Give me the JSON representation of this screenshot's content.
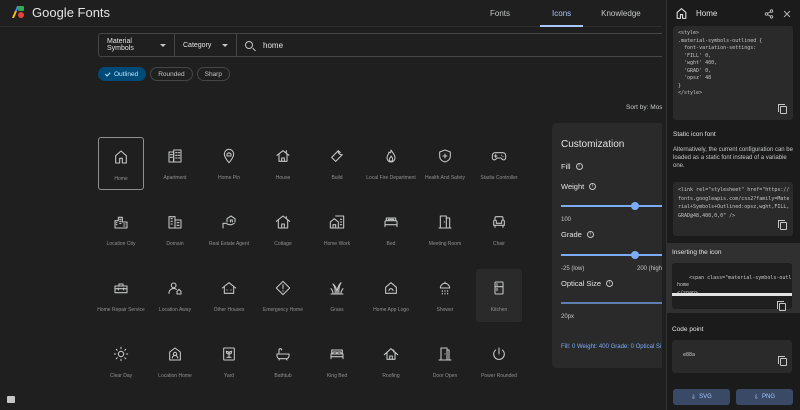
{
  "header": {
    "brand": "Google Fonts",
    "nav": [
      "Fonts",
      "Icons",
      "Knowledge",
      "F"
    ],
    "active_nav": "Icons"
  },
  "search": {
    "family": "Material Symbols",
    "category": "Category",
    "query": "home"
  },
  "styles": [
    "Outlined",
    "Rounded",
    "Sharp"
  ],
  "sort_label": "Sort by: Most",
  "icons": [
    {
      "label": "Home",
      "icon": "home-icon"
    },
    {
      "label": "Apartment",
      "icon": "apartment-icon"
    },
    {
      "label": "Home Pin",
      "icon": "home-pin-icon"
    },
    {
      "label": "House",
      "icon": "house-icon"
    },
    {
      "label": "Build",
      "icon": "build-icon"
    },
    {
      "label": "Local Fire Department",
      "icon": "fire-icon"
    },
    {
      "label": "Health And Safety",
      "icon": "health-icon"
    },
    {
      "label": "Stadia Controller",
      "icon": "controller-icon"
    },
    {
      "label": "Location City",
      "icon": "city-icon"
    },
    {
      "label": "Domain",
      "icon": "domain-icon"
    },
    {
      "label": "Real Estate Agent",
      "icon": "agent-icon"
    },
    {
      "label": "Cottage",
      "icon": "cottage-icon"
    },
    {
      "label": "Home Work",
      "icon": "home-work-icon"
    },
    {
      "label": "Bed",
      "icon": "bed-icon"
    },
    {
      "label": "Meeting Room",
      "icon": "meeting-room-icon"
    },
    {
      "label": "Chair",
      "icon": "chair-icon"
    },
    {
      "label": "Home Repair Service",
      "icon": "toolbox-icon"
    },
    {
      "label": "Location Away",
      "icon": "location-away-icon"
    },
    {
      "label": "Other Houses",
      "icon": "other-houses-icon"
    },
    {
      "label": "Emergency Home",
      "icon": "emergency-home-icon"
    },
    {
      "label": "Grass",
      "icon": "grass-icon"
    },
    {
      "label": "Home App Logo",
      "icon": "home-app-logo-icon"
    },
    {
      "label": "Shower",
      "icon": "shower-icon"
    },
    {
      "label": "Kitchen",
      "icon": "kitchen-icon"
    },
    {
      "label": "Clear Day",
      "icon": "sun-icon"
    },
    {
      "label": "Location Home",
      "icon": "location-home-icon"
    },
    {
      "label": "Yard",
      "icon": "yard-icon"
    },
    {
      "label": "Bathtub",
      "icon": "bathtub-icon"
    },
    {
      "label": "King Bed",
      "icon": "king-bed-icon"
    },
    {
      "label": "Roofing",
      "icon": "roofing-icon"
    },
    {
      "label": "Door Open",
      "icon": "door-open-icon"
    },
    {
      "label": "Power Rounded",
      "icon": "power-icon"
    }
  ],
  "customization": {
    "title": "Customization",
    "fill_label": "Fill",
    "weight_label": "Weight",
    "weight_min": "100",
    "weight_value": 400,
    "grade_label": "Grade",
    "grade_min": "-25 (low)",
    "grade_mid": "200 (high",
    "grade_value": 0,
    "optical_label": "Optical Size",
    "optical_min": "20px",
    "optical_value": 48,
    "summary": "Fill: 0 Weight: 400 Grade: 0 Optical Si"
  },
  "side": {
    "title": "Home",
    "style_code": "<style>\n.material-symbols-outlined {\n  font-variation-settings:\n  'FILL' 0,\n  'wght' 400,\n  'GRAD' 0,\n  'opsz' 48\n}\n</style>",
    "static_title": "Static icon font",
    "static_text": "Alternatively, the current configuration can be loaded as a static font instead of a variable one.",
    "link_code": "<link rel=\"stylesheet\" href=\"https://\nfonts.googleapis.com/css2?family=Mate\nrial+Symbols+Outlined:opsz,wght,FILL,\nGRAD@48,400,0,0\" />",
    "insert_title": "Inserting the icon",
    "insert_code": "<span class=\"material-symbols-outlined\">\nhome\n</span>",
    "codepoint_title": "Code point",
    "codepoint": "e88a",
    "svg_label": "SVG",
    "png_label": "PNG"
  },
  "colors": {
    "accent": "#a8c7fa",
    "chip_on": "#004a77",
    "bg": "#1f1f1f"
  }
}
